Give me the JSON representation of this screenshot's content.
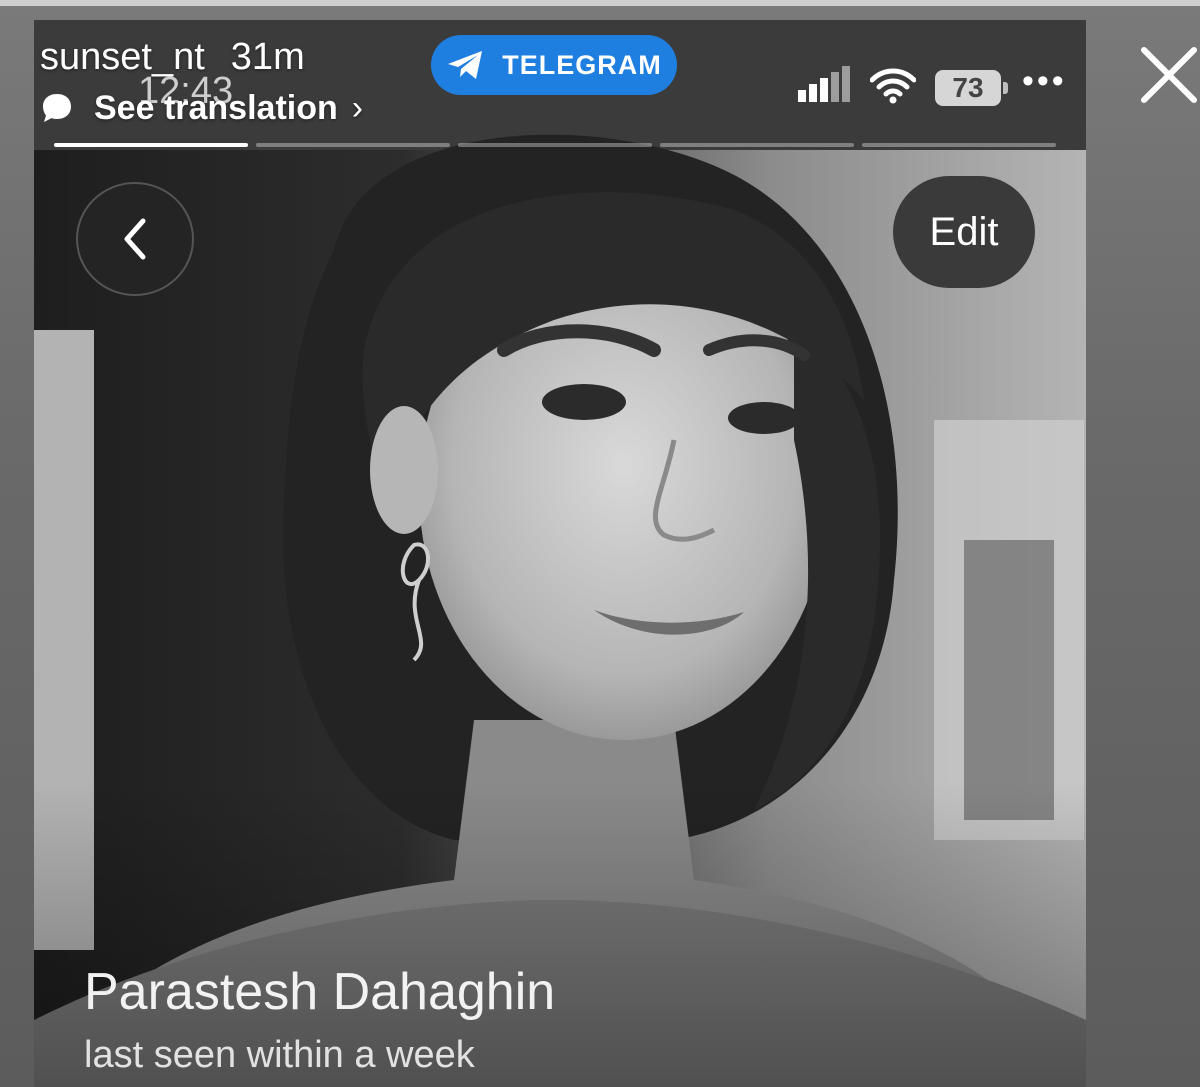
{
  "story": {
    "username": "sunset_nt",
    "posted_ago": "31m",
    "see_translation": "See translation",
    "chevron": "›"
  },
  "status_bar": {
    "time": "12:43",
    "app_pill": "TELEGRAM",
    "battery": "73",
    "more": "•••"
  },
  "profile": {
    "edit_label": "Edit",
    "name": "Parastesh Dahaghin",
    "last_seen": "last seen within a week"
  },
  "colors": {
    "telegram_pill": "#1f7fe0",
    "background": "#6e6e6e"
  },
  "icons": [
    "telegram-icon",
    "signal-icon",
    "wifi-icon",
    "battery-icon",
    "more-icon",
    "close-icon",
    "back-icon",
    "chat-bubble-icon"
  ]
}
